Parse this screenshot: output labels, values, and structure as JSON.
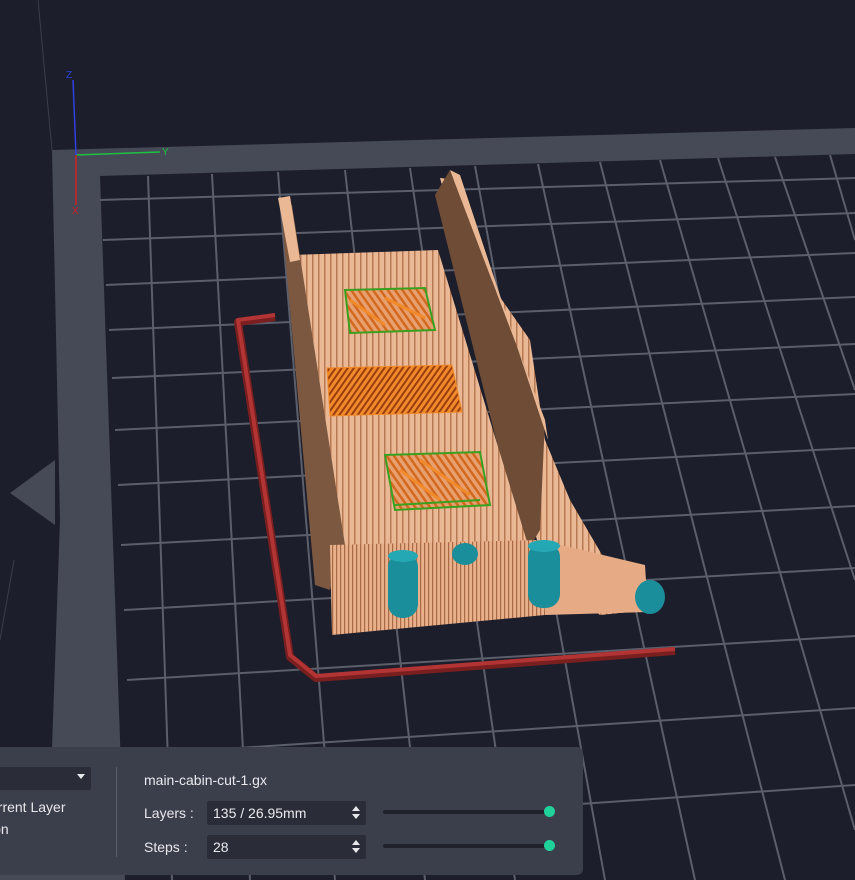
{
  "viewport": {
    "axes": {
      "x_label": "X",
      "y_label": "Y",
      "z_label": "Z"
    },
    "colors": {
      "background": "#1c1e2b",
      "bed_border": "#4a4d5a",
      "grid_lines": "#5a5d6a",
      "model_body": "#e8b08a",
      "model_wall": "#8a6248",
      "infill": "#e07a1f",
      "support": "#1a8e9a",
      "travel": "#b03030",
      "axis_x": "#d02020",
      "axis_y": "#20c040",
      "axis_z": "#3040e0",
      "slider_thumb": "#1fd29a"
    }
  },
  "panel": {
    "view_mode_dropdown": "",
    "options": [
      "urrent Layer",
      "ion"
    ],
    "file_name": "main-cabin-cut-1.gx",
    "layers": {
      "label": "Layers :",
      "value": "135 / 26.95mm",
      "slider_fraction": 1.0
    },
    "steps": {
      "label": "Steps :",
      "value": "28",
      "slider_fraction": 1.0
    }
  }
}
